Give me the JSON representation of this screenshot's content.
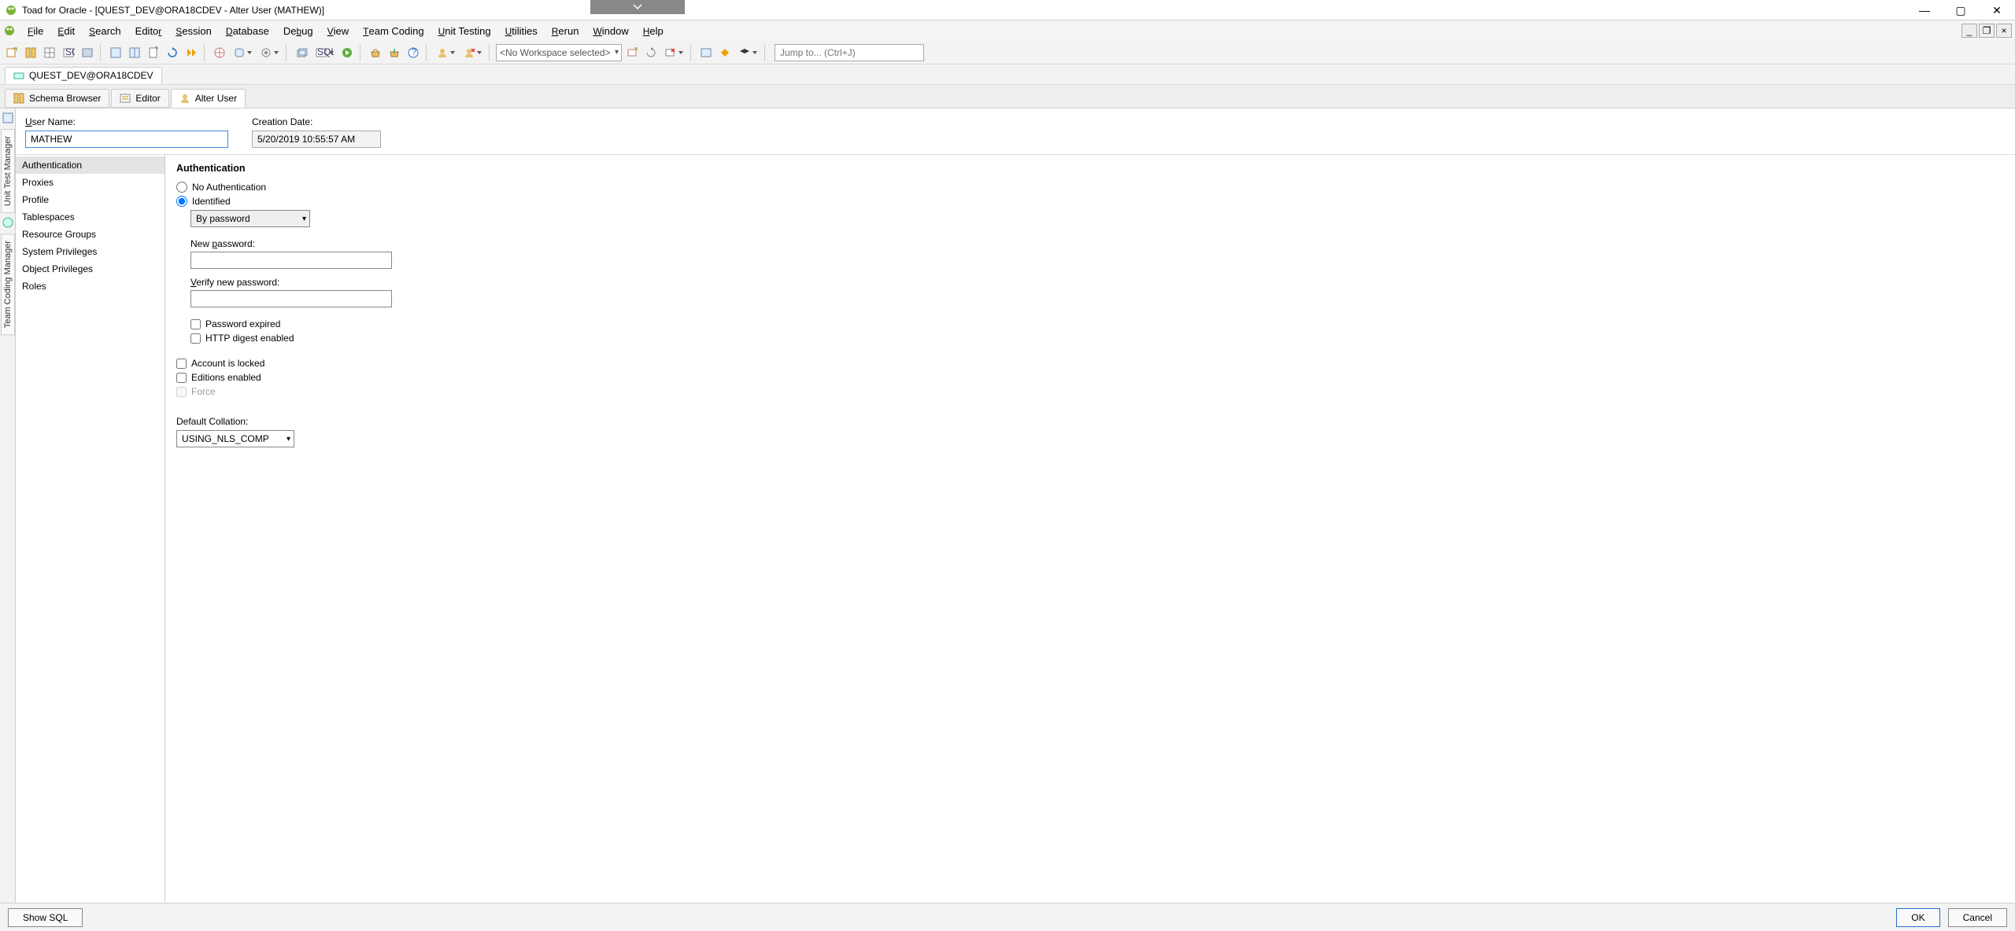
{
  "titlebar": {
    "title": "Toad for Oracle - [QUEST_DEV@ORA18CDEV - Alter User (MATHEW)]"
  },
  "menu": {
    "items": [
      "File",
      "Edit",
      "Search",
      "Editor",
      "Session",
      "Database",
      "Debug",
      "View",
      "Team Coding",
      "Unit Testing",
      "Utilities",
      "Rerun",
      "Window",
      "Help"
    ]
  },
  "toolbar": {
    "workspace_placeholder": "<No Workspace selected>",
    "jumpto_placeholder": "Jump to... (Ctrl+J)"
  },
  "connection_tab": "QUEST_DEV@ORA18CDEV",
  "doc_tabs": [
    {
      "label": "Schema Browser",
      "active": false
    },
    {
      "label": "Editor",
      "active": false
    },
    {
      "label": "Alter User",
      "active": true
    }
  ],
  "vert_tabs": [
    "Unit Test Manager",
    "Team Coding Manager"
  ],
  "header": {
    "username_label": "User Name:",
    "username_value": "MATHEW",
    "creation_label": "Creation Date:",
    "creation_value": "5/20/2019 10:55:57 AM"
  },
  "nav": {
    "items": [
      "Authentication",
      "Proxies",
      "Profile",
      "Tablespaces",
      "Resource Groups",
      "System Privileges",
      "Object Privileges",
      "Roles"
    ],
    "selected_index": 0
  },
  "auth": {
    "heading": "Authentication",
    "no_auth_label": "No Authentication",
    "identified_label": "Identified",
    "identified_mode": "By password",
    "new_password_label": "New password:",
    "verify_password_label": "Verify new password:",
    "password_expired_label": "Password expired",
    "http_digest_label": "HTTP digest enabled",
    "account_locked_label": "Account is locked",
    "editions_enabled_label": "Editions enabled",
    "force_label": "Force",
    "default_collation_label": "Default Collation:",
    "default_collation_value": "USING_NLS_COMP"
  },
  "footer": {
    "show_sql": "Show SQL",
    "ok": "OK",
    "cancel": "Cancel"
  }
}
